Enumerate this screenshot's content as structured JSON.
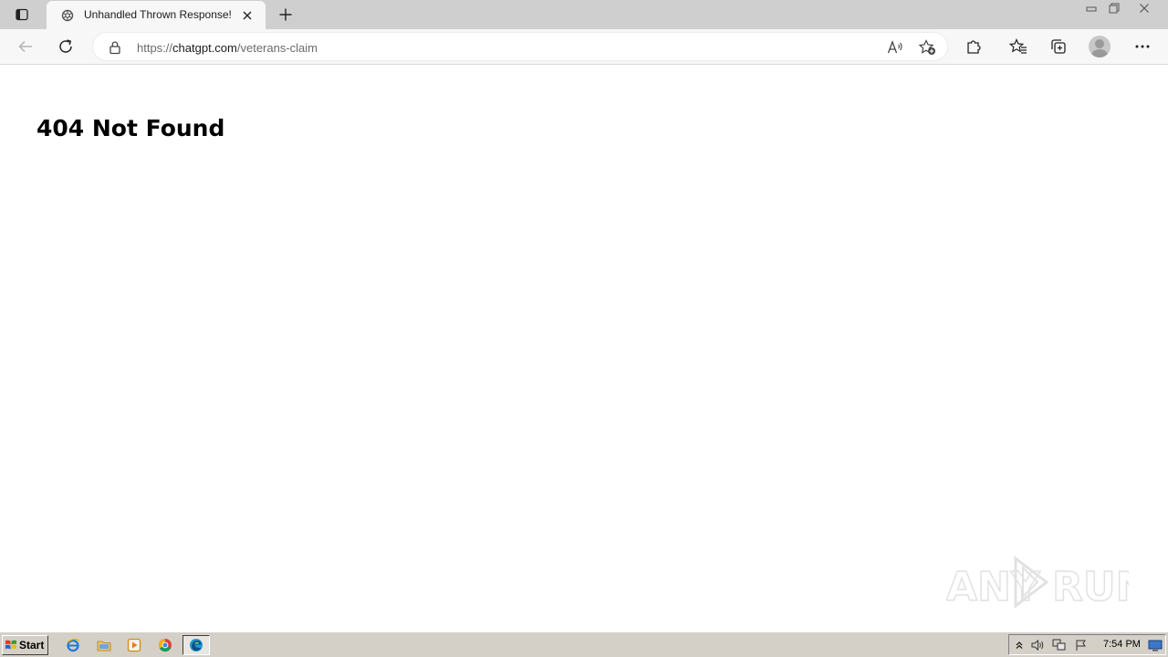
{
  "browser": {
    "tab": {
      "title": "Unhandled Thrown Response!"
    },
    "address_bar": {
      "url_scheme": "https://",
      "url_host": "chatgpt.com",
      "url_path": "/veterans-claim"
    }
  },
  "page": {
    "heading": "404 Not Found"
  },
  "watermark": {
    "left_text": "ANY",
    "right_text": "RUN"
  },
  "taskbar": {
    "start_label": "Start",
    "clock": "7:54 PM"
  },
  "colors": {
    "tabstrip_bg": "#cfcfcf",
    "toolbar_bg": "#f7f7f7",
    "taskbar_bg": "#d4d0c8",
    "edge_blue": "#0f6cbd"
  }
}
